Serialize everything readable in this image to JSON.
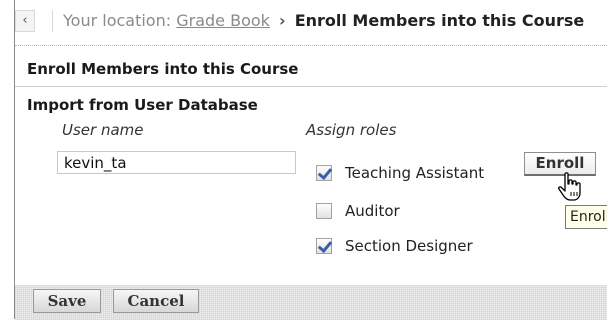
{
  "breadcrumb": {
    "back_glyph": "‹",
    "prefix": "Your location:",
    "link": "Grade Book",
    "separator": "›",
    "current": "Enroll Members into this Course"
  },
  "page_title": "Enroll Members into this Course",
  "section": {
    "title": "Import from User Database",
    "username_label": "User name",
    "roles_label": "Assign roles"
  },
  "username_input": {
    "value": "kevin_ta"
  },
  "roles": [
    {
      "label": "Teaching Assistant",
      "checked": true
    },
    {
      "label": "Auditor",
      "checked": false
    },
    {
      "label": "Section Designer",
      "checked": true
    }
  ],
  "enroll_button": {
    "label": "Enroll"
  },
  "tooltip": {
    "text": "Enroll"
  },
  "footer": {
    "save_label": "Save",
    "cancel_label": "Cancel"
  },
  "colors": {
    "checkmark": "#3a5fa8",
    "tooltip_bg": "#ffffe8",
    "footer_bg": "#ededed"
  },
  "icons": {
    "cursor": "hand-pointer-icon",
    "back": "chevron-left-icon"
  }
}
